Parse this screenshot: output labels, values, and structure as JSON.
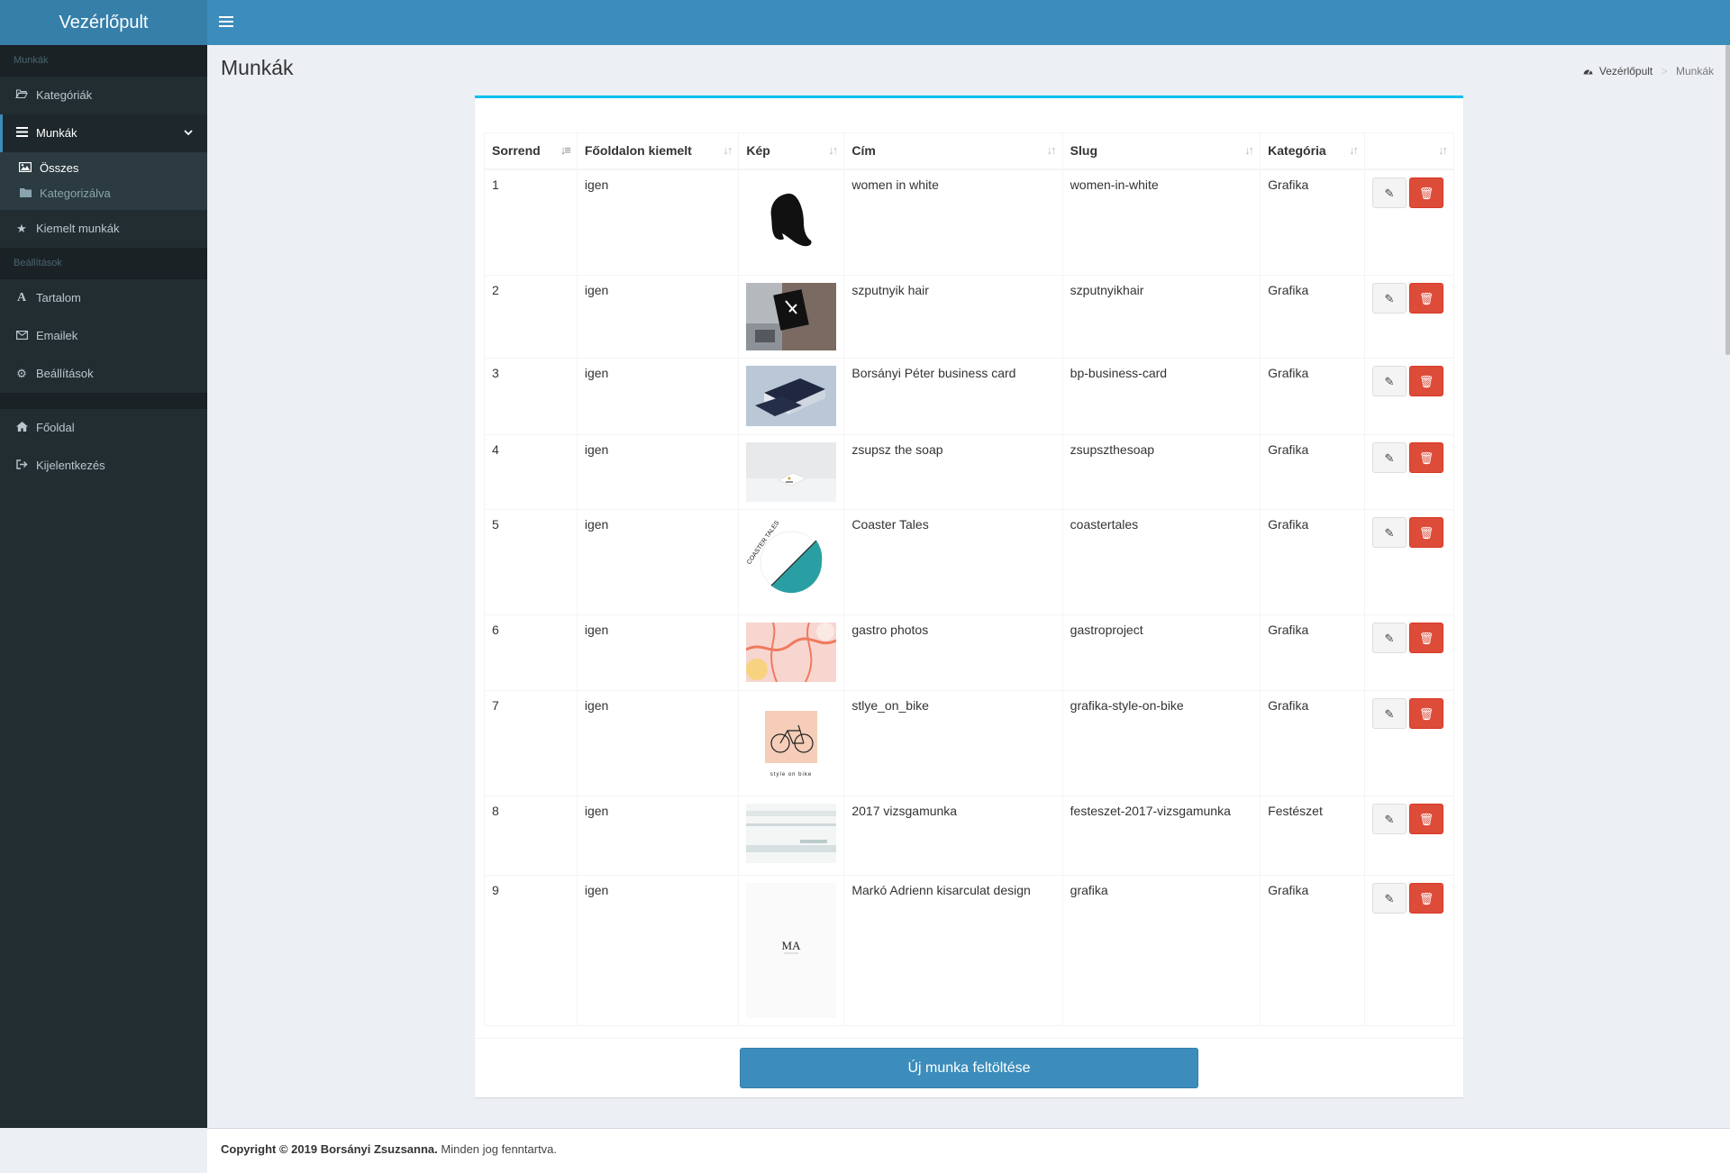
{
  "app": {
    "logo": "Vezérlőpult"
  },
  "sidebar": {
    "section1": "Munkák",
    "categories": "Kategóriák",
    "works": "Munkák",
    "sub_all": "Összes",
    "sub_categorized": "Kategorizálva",
    "featured": "Kiemelt munkák",
    "section2": "Beállítások",
    "content": "Tartalom",
    "emails": "Emailek",
    "settings": "Beállítások",
    "home": "Főoldal",
    "logout": "Kijelentkezés"
  },
  "page": {
    "title": "Munkák",
    "breadcrumb_home": "Vezérlőpult",
    "breadcrumb_current": "Munkák",
    "upload_button": "Új munka feltöltése"
  },
  "table": {
    "columns": [
      "Sorrend",
      "Főoldalon kiemelt",
      "Kép",
      "Cím",
      "Slug",
      "Kategória",
      ""
    ],
    "rows": [
      {
        "order": "1",
        "featured": "igen",
        "image": "woman-silhouette",
        "title": "women in white",
        "slug": "women-in-white",
        "category": "Grafika"
      },
      {
        "order": "2",
        "featured": "igen",
        "image": "szputnyik-sign",
        "title": "szputnyik hair",
        "slug": "szputnyikhair",
        "category": "Grafika"
      },
      {
        "order": "3",
        "featured": "igen",
        "image": "business-cards",
        "title": "Borsányi Péter business card",
        "slug": "bp-business-card",
        "category": "Grafika"
      },
      {
        "order": "4",
        "featured": "igen",
        "image": "soap-card",
        "title": "zsupsz the soap",
        "slug": "zsupszthesoap",
        "category": "Grafika"
      },
      {
        "order": "5",
        "featured": "igen",
        "image": "coaster-tales-logo",
        "title": "Coaster Tales",
        "slug": "coastertales",
        "category": "Grafika"
      },
      {
        "order": "6",
        "featured": "igen",
        "image": "gastro-map",
        "title": "gastro photos",
        "slug": "gastroproject",
        "category": "Grafika"
      },
      {
        "order": "7",
        "featured": "igen",
        "image": "bike-logo",
        "title": "stlye_on_bike",
        "slug": "grafika-style-on-bike",
        "category": "Grafika"
      },
      {
        "order": "8",
        "featured": "igen",
        "image": "painting",
        "title": "2017 vizsgamunka",
        "slug": "festeszet-2017-vizsgamunka",
        "category": "Festészet"
      },
      {
        "order": "9",
        "featured": "igen",
        "image": "ma-logo",
        "title": "Markó Adrienn kisarculat design",
        "slug": "grafika",
        "category": "Grafika"
      }
    ]
  },
  "thumbs": {
    "coaster_text": "COASTER TALES",
    "bike_text": "style on bike",
    "ma_text": "MA"
  },
  "footer": {
    "copyright": "Copyright © 2019 Borsányi Zsuzsanna.",
    "rights": "Minden jog fenntartva."
  },
  "colors": {
    "header": "#3c8dbc",
    "sidebar": "#222d32",
    "danger": "#dd4b39",
    "box_accent": "#00c0ef"
  }
}
